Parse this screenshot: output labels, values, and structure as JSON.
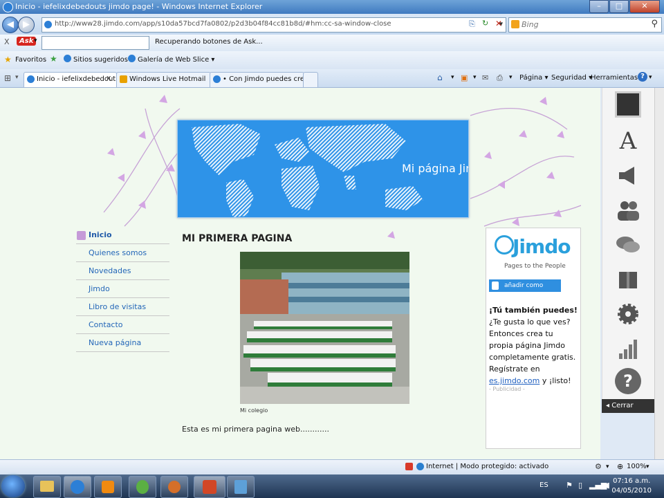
{
  "window": {
    "title": "Inicio - iefelixdebedouts jimdo page! - Windows Internet Explorer",
    "minimize_glyph": "–",
    "maximize_glyph": "□",
    "close_glyph": "✕"
  },
  "address_bar": {
    "url": "http://www28.jimdo.com/app/s10da57bcd7fa0802/p2d3b04f84cc81b8d/#hm:cc-sa-window-close",
    "search_placeholder": "Bing"
  },
  "ask_toolbar": {
    "close_glyph": "X",
    "logo": "Ask",
    "status": "Recuperando botones de Ask..."
  },
  "favorites_bar": {
    "favorites": "Favoritos",
    "suggested": "Sitios sugeridos ▾",
    "web_slice": "Galería de Web Slice ▾"
  },
  "tabs": [
    {
      "label": "Inicio - iefelixdebedout...",
      "close": "x"
    },
    {
      "label": "Windows Live Hotmail"
    },
    {
      "label": "• Con Jimdo puedes crear ..."
    }
  ],
  "command_bar": {
    "page": "Página ▾",
    "safety": "Seguridad ▾",
    "tools": "Herramientas ▾"
  },
  "site": {
    "banner_title": "Mi página Jim",
    "nav": [
      "Inicio",
      "Quienes somos",
      "Novedades",
      "Jimdo",
      "Libro de visitas",
      "Contacto",
      "Nueva página"
    ],
    "heading": "MI PRIMERA PAGINA",
    "photo_caption": "Mi colegio",
    "body_text": "Esta es mi primera pagina web............"
  },
  "sidebar": {
    "logo": "Jimdo",
    "tagline": "Pages to the People",
    "add_friend": "añadir como amigo(s)",
    "headline": "¡Tú también puedes!",
    "text": "¿Te gusta lo que ves? Entonces crea tu propia página Jimdo completamente gratis. Regístrate en",
    "link": "es.jimdo.com",
    "tail": " y ¡listo!",
    "ad": "- Publicidad -"
  },
  "jimdo_tools": {
    "close": "Cerrar"
  },
  "status_bar": {
    "zone": "Internet | Modo protegido: activado",
    "zoom": "100%"
  },
  "taskbar": {
    "language": "ES",
    "time": "07:16 a.m.",
    "date": "04/05/2010"
  },
  "colors": {
    "accent_blue": "#2e93e8",
    "page_bg": "#f1f9ef",
    "link": "#2366b8"
  }
}
